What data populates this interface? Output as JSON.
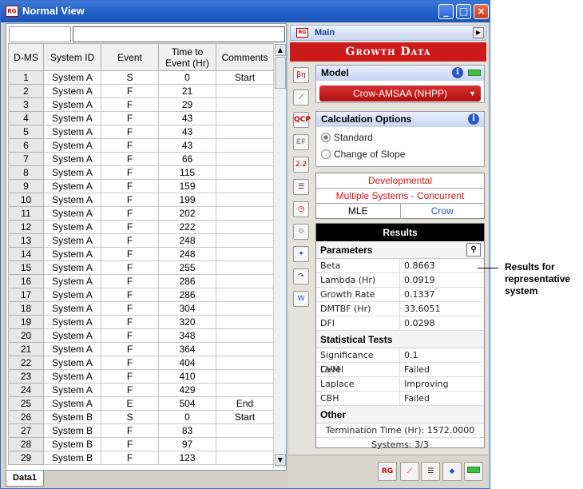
{
  "window": {
    "title": "Normal View",
    "app_badge": "RG"
  },
  "grid": {
    "headers": [
      "D-MS",
      "System ID",
      "Event",
      "Time to\nEvent (Hr)",
      "Comments"
    ],
    "rows": [
      [
        "1",
        "System A",
        "S",
        "0",
        "Start"
      ],
      [
        "2",
        "System A",
        "F",
        "21",
        ""
      ],
      [
        "3",
        "System A",
        "F",
        "29",
        ""
      ],
      [
        "4",
        "System A",
        "F",
        "43",
        ""
      ],
      [
        "5",
        "System A",
        "F",
        "43",
        ""
      ],
      [
        "6",
        "System A",
        "F",
        "43",
        ""
      ],
      [
        "7",
        "System A",
        "F",
        "66",
        ""
      ],
      [
        "8",
        "System A",
        "F",
        "115",
        ""
      ],
      [
        "9",
        "System A",
        "F",
        "159",
        ""
      ],
      [
        "10",
        "System A",
        "F",
        "199",
        ""
      ],
      [
        "11",
        "System A",
        "F",
        "202",
        ""
      ],
      [
        "12",
        "System A",
        "F",
        "222",
        ""
      ],
      [
        "13",
        "System A",
        "F",
        "248",
        ""
      ],
      [
        "14",
        "System A",
        "F",
        "248",
        ""
      ],
      [
        "15",
        "System A",
        "F",
        "255",
        ""
      ],
      [
        "16",
        "System A",
        "F",
        "286",
        ""
      ],
      [
        "17",
        "System A",
        "F",
        "286",
        ""
      ],
      [
        "18",
        "System A",
        "F",
        "304",
        ""
      ],
      [
        "19",
        "System A",
        "F",
        "320",
        ""
      ],
      [
        "20",
        "System A",
        "F",
        "348",
        ""
      ],
      [
        "21",
        "System A",
        "F",
        "364",
        ""
      ],
      [
        "22",
        "System A",
        "F",
        "404",
        ""
      ],
      [
        "23",
        "System A",
        "F",
        "410",
        ""
      ],
      [
        "24",
        "System A",
        "F",
        "429",
        ""
      ],
      [
        "25",
        "System A",
        "E",
        "504",
        "End"
      ],
      [
        "26",
        "System B",
        "S",
        "0",
        "Start"
      ],
      [
        "27",
        "System B",
        "F",
        "83",
        ""
      ],
      [
        "28",
        "System B",
        "F",
        "97",
        ""
      ],
      [
        "29",
        "System B",
        "F",
        "123",
        ""
      ]
    ]
  },
  "sheet_tab": "Data1",
  "panel": {
    "main_label": "Main",
    "banner": "Growth Data",
    "model": {
      "header": "Model",
      "selected": "Crow-AMSAA (NHPP)"
    },
    "calc": {
      "header": "Calculation Options",
      "options": [
        "Standard",
        "Change of Slope"
      ],
      "selected": 0
    },
    "info": {
      "row1": "Developmental",
      "row2": "Multiple Systems - Concurrent",
      "method": "MLE",
      "method2": "Crow"
    },
    "results": {
      "header": "Results",
      "parameters_header": "Parameters",
      "parameters": [
        {
          "k": "Beta",
          "v": "0.8663"
        },
        {
          "k": "Lambda (Hr)",
          "v": "0.0919"
        },
        {
          "k": "Growth Rate",
          "v": "0.1337"
        },
        {
          "k": "DMTBF (Hr)",
          "v": "33.6051"
        },
        {
          "k": "DFI",
          "v": "0.0298"
        }
      ],
      "tests_header": "Statistical Tests",
      "tests": [
        {
          "k": "Significance Level",
          "v": "0.1"
        },
        {
          "k": "CVM",
          "v": "Failed"
        },
        {
          "k": "Laplace",
          "v": "Improving"
        },
        {
          "k": "CBH",
          "v": "Failed"
        }
      ],
      "other_header": "Other",
      "termination": "Termination Time (Hr): 1572.0000",
      "systems": "Systems: 3/3"
    }
  },
  "callout": "Results for representative system",
  "colors": {
    "banner": "#cc1a1a",
    "accent": "#2a56c6"
  }
}
